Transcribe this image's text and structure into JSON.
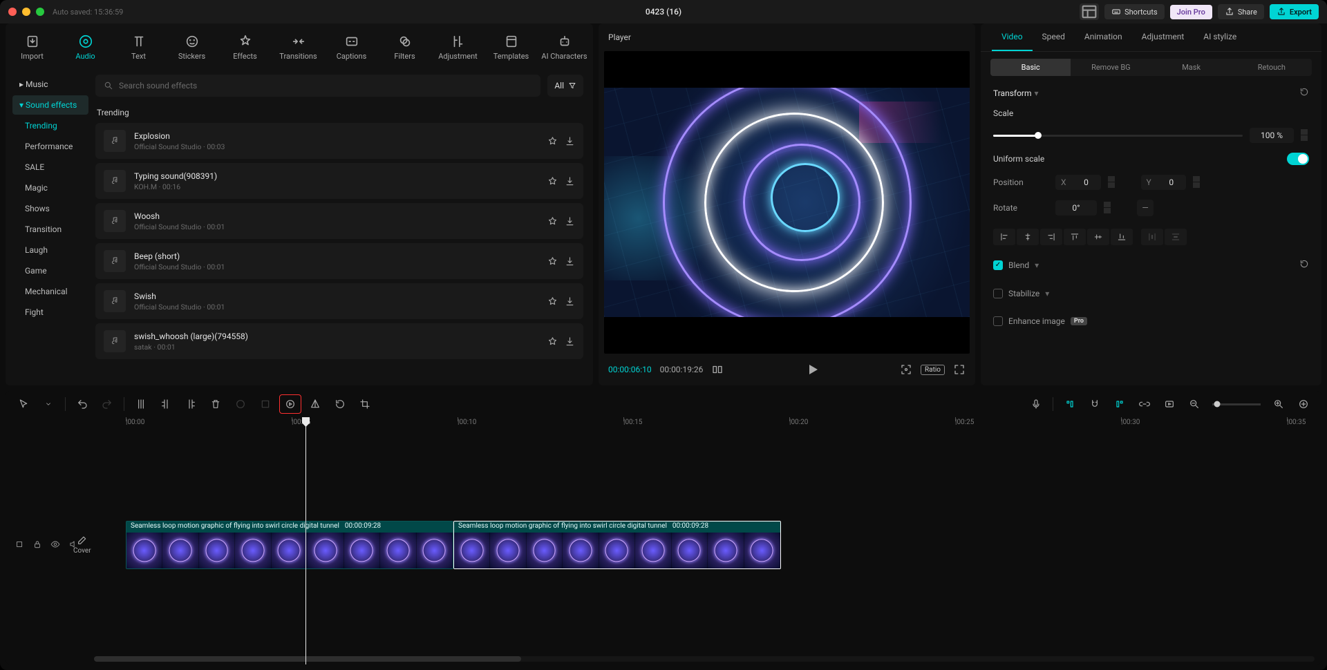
{
  "titlebar": {
    "autosave": "Auto saved: 15:36:59",
    "doc": "0423 (16)",
    "shortcuts": "Shortcuts",
    "join_pro": "Join Pro",
    "share": "Share",
    "export": "Export"
  },
  "topTools": [
    {
      "id": "import",
      "label": "Import"
    },
    {
      "id": "audio",
      "label": "Audio"
    },
    {
      "id": "text",
      "label": "Text"
    },
    {
      "id": "stickers",
      "label": "Stickers"
    },
    {
      "id": "effects",
      "label": "Effects"
    },
    {
      "id": "transitions",
      "label": "Transitions"
    },
    {
      "id": "captions",
      "label": "Captions"
    },
    {
      "id": "filters",
      "label": "Filters"
    },
    {
      "id": "adjustment",
      "label": "Adjustment"
    },
    {
      "id": "templates",
      "label": "Templates"
    },
    {
      "id": "ai",
      "label": "AI Characters"
    }
  ],
  "sidebar": {
    "music": "Music",
    "sfx": "Sound effects",
    "subs": [
      "Trending",
      "Performance",
      "SALE",
      "Magic",
      "Shows",
      "Transition",
      "Laugh",
      "Game",
      "Mechanical",
      "Fight"
    ]
  },
  "search": {
    "placeholder": "Search sound effects",
    "all": "All"
  },
  "section": "Trending",
  "tracks": [
    {
      "title": "Explosion",
      "meta": "Official Sound Studio  ·  00:03"
    },
    {
      "title": "Typing sound(908391)",
      "meta": "KOH.M  ·  00:16"
    },
    {
      "title": "Woosh",
      "meta": "Official Sound Studio  ·  00:01"
    },
    {
      "title": "Beep (short)",
      "meta": "Official Sound Studio  ·  00:01"
    },
    {
      "title": "Swish",
      "meta": "Official Sound Studio  ·  00:01"
    },
    {
      "title": "swish_whoosh (large)(794558)",
      "meta": "satak  ·  00:01"
    }
  ],
  "player": {
    "title": "Player",
    "cur": "00:00:06:10",
    "tot": "00:00:19:26",
    "ratio": "Ratio"
  },
  "props": {
    "tabs": [
      "Video",
      "Speed",
      "Animation",
      "Adjustment",
      "AI stylize"
    ],
    "subtabs": [
      "Basic",
      "Remove BG",
      "Mask",
      "Retouch"
    ],
    "transform": "Transform",
    "scale": "Scale",
    "scale_val": "100 %",
    "uniform": "Uniform scale",
    "position": "Position",
    "px": "X",
    "py": "Y",
    "pxv": "0",
    "pyv": "0",
    "rotate": "Rotate",
    "rv": "0°",
    "blend": "Blend",
    "stabilize": "Stabilize",
    "enhance": "Enhance image",
    "pro": "Pro"
  },
  "timeline": {
    "ticks": [
      "|00:00",
      "|00:05",
      "|00:10",
      "|00:15",
      "|00:20",
      "|00:25",
      "|00:30",
      "|00:35"
    ],
    "cover": "Cover",
    "clip_name": "Seamless loop motion graphic of flying into swirl circle digital tunnel",
    "clip_dur": "00:00:09:28"
  }
}
